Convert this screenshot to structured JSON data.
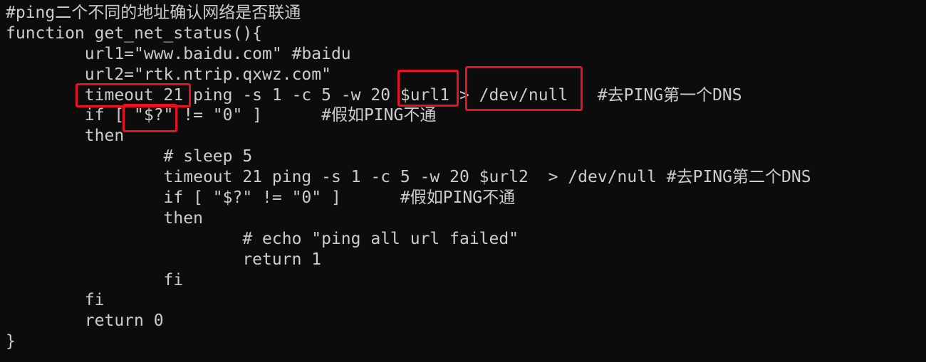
{
  "terminal": {
    "lines": [
      "#ping二个不同的地址确认网络是否联通",
      "function get_net_status(){",
      "        url1=\"www.baidu.com\" #baidu",
      "        url2=\"rtk.ntrip.qxwz.com\"",
      "        timeout 21 ping -s 1 -c 5 -w 20 $url1 > /dev/null   #去PING第一个DNS",
      "        if [ \"$?\" != \"0\" ]      #假如PING不通",
      "        then",
      "                # sleep 5",
      "                timeout 21 ping -s 1 -c 5 -w 20 $url2  > /dev/null #去PING第二个DNS",
      "                if [ \"$?\" != \"0\" ]      #假如PING不通",
      "                then",
      "                        # echo \"ping all url failed\"",
      "                        return 1",
      "                fi",
      "        fi",
      "        return 0",
      "}"
    ]
  },
  "annotations": {
    "color": "#e81123",
    "boxes": [
      "timeout-highlight",
      "exit-status-highlight",
      "url1-highlight",
      "dev-null-highlight"
    ]
  }
}
